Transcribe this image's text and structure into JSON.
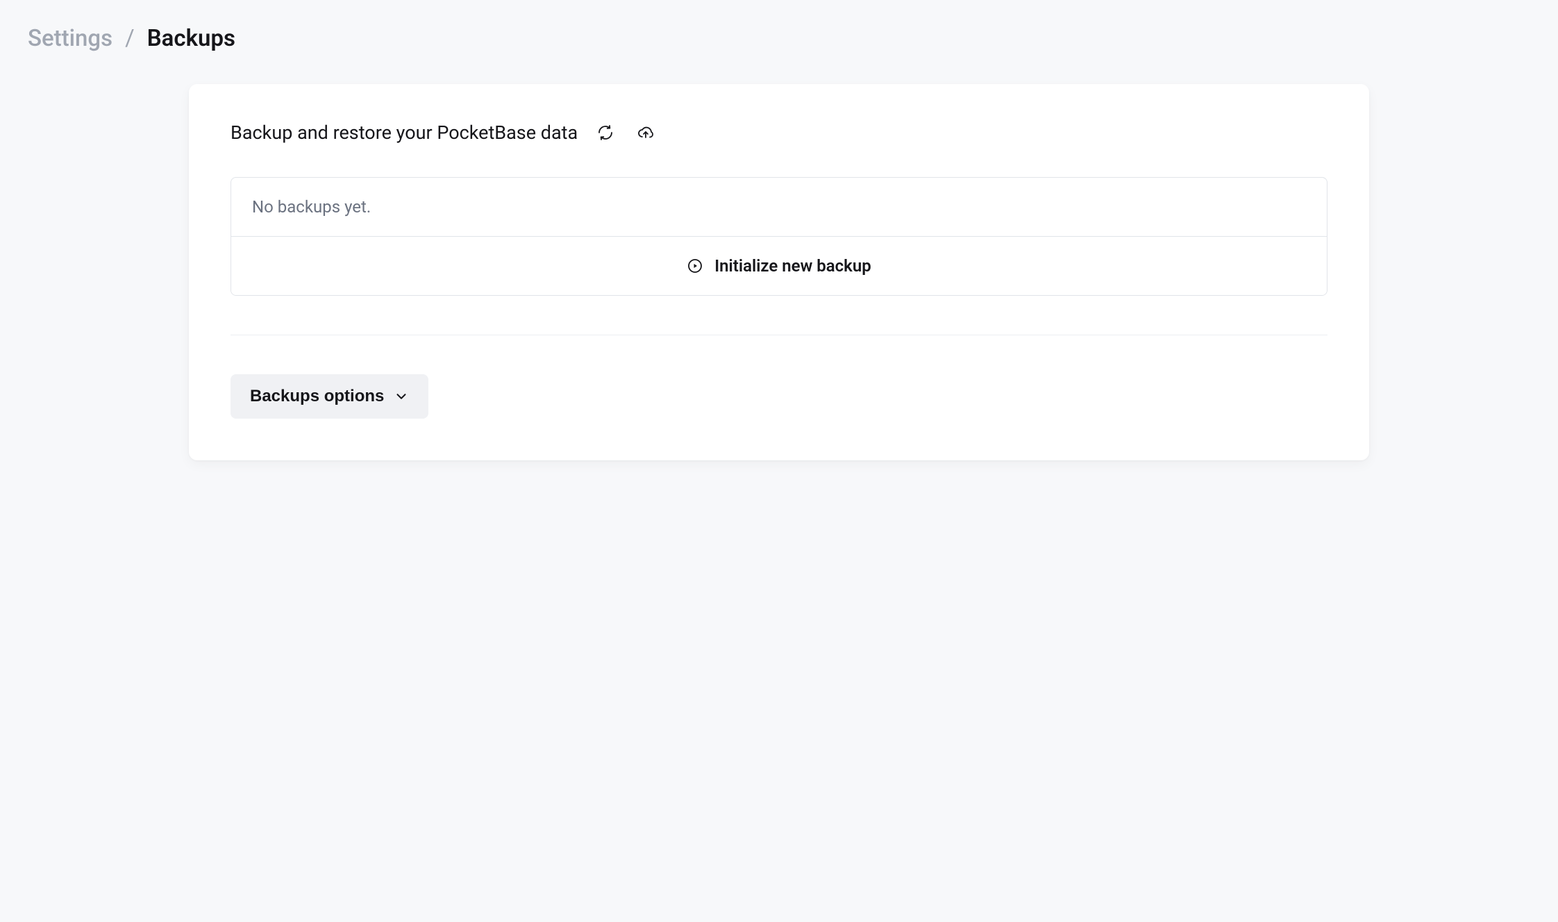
{
  "breadcrumb": {
    "parent": "Settings",
    "separator": "/",
    "current": "Backups"
  },
  "card": {
    "header_title": "Backup and restore your PocketBase data",
    "refresh_icon": "loop-icon",
    "upload_icon": "upload-cloud-icon",
    "empty_message": "No backups yet.",
    "initialize_label": "Initialize new backup",
    "options_label": "Backups options"
  }
}
